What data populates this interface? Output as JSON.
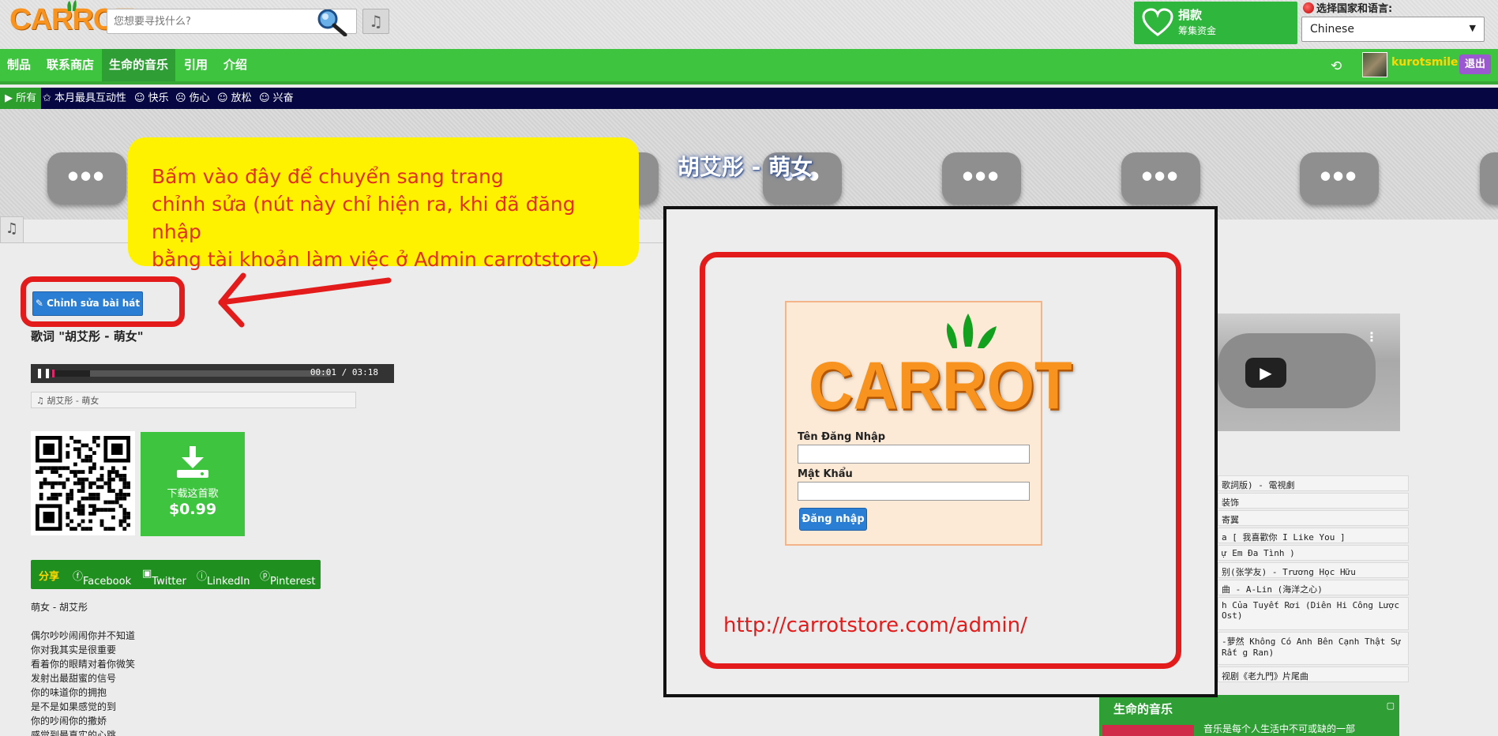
{
  "header": {
    "logo_text": "CARROT",
    "search_placeholder": "您想要寻找什么?",
    "donate_title": "捐款",
    "donate_subtitle": "筹集资金",
    "language_label": "选择国家和语言:",
    "language_value": "Chinese"
  },
  "nav": {
    "items": [
      "制品",
      "联系商店",
      "生命的音乐",
      "引用",
      "介绍"
    ],
    "active_index": 2,
    "username": "kurotsmile",
    "logout_label": "退出"
  },
  "mood_bar": {
    "items": [
      "▶ 所有",
      "✩ 本月最具互动性",
      "☺ 快乐",
      "☹ 伤心",
      "☺ 放松",
      "☺ 兴奋"
    ]
  },
  "banner": {
    "song_title": "胡艾彤 - 萌女"
  },
  "callout": {
    "line1": "Bấm vào đây để chuyển sang trang",
    "line2": "chỉnh sửa (nút này chỉ hiện ra, khi đã đăng nhập",
    "line3": "bằng tài khoản làm việc ở Admin carrotstore)"
  },
  "song": {
    "edit_button": "Chỉnh sửa bài hát",
    "lyrics_heading": "歌词 \"胡艾彤 - 萌女\"",
    "time_current": "00:01",
    "time_total": "03:18",
    "song_line": "♫ 胡艾彤 - 萌女",
    "download_label": "下载这首歌",
    "price": "$0.99",
    "progress_fraction": 0.005
  },
  "share": {
    "label": "分享",
    "items": [
      "Facebook",
      "Twitter",
      "LinkedIn",
      "Pinterest"
    ]
  },
  "lyrics": {
    "head": "萌女 - 胡艾彤",
    "lines": [
      "偶尔吵吵闹闹你并不知道",
      "你对我其实是很重要",
      "看着你的眼睛对着你微笑",
      "发射出最甜蜜的信号",
      "你的味道你的拥抱",
      "是不是如果感觉的到",
      "你的吵闹你的撒娇",
      "感觉到最真实的心跳"
    ]
  },
  "admin": {
    "logo_text": "CARROT",
    "username_label": "Tên Đăng Nhập",
    "password_label": "Mật Khẩu",
    "login_button": "Đăng nhập",
    "url": "http://carrotstore.com/admin/"
  },
  "playlist": {
    "rows": [
      "歌詞版) - 電視劇",
      "装饰",
      "寄翼",
      "a [ 我喜歡你 I Like You ]",
      "ự Em Đa Tình )",
      "别(张学友) - Trương Học Hữu",
      "曲 - A-Lin (海洋之心)",
      "h Của Tuyết Rơi (Diên Hi Công Lược Ost)",
      "-萝然 Không Có Anh Bên Cạnh Thật Sự Rất g Ran)",
      "视剧《老九門》片尾曲"
    ]
  },
  "life_music": {
    "title": "生命的音乐",
    "desc": "音乐是每个人生活中不可或缺的一部"
  },
  "colors": {
    "nav_green": "#3fc43f",
    "dark_navy": "#060643",
    "carrot_orange": "#f7931e",
    "annotation_red": "#e31b1b",
    "callout_yellow": "#fff200"
  }
}
